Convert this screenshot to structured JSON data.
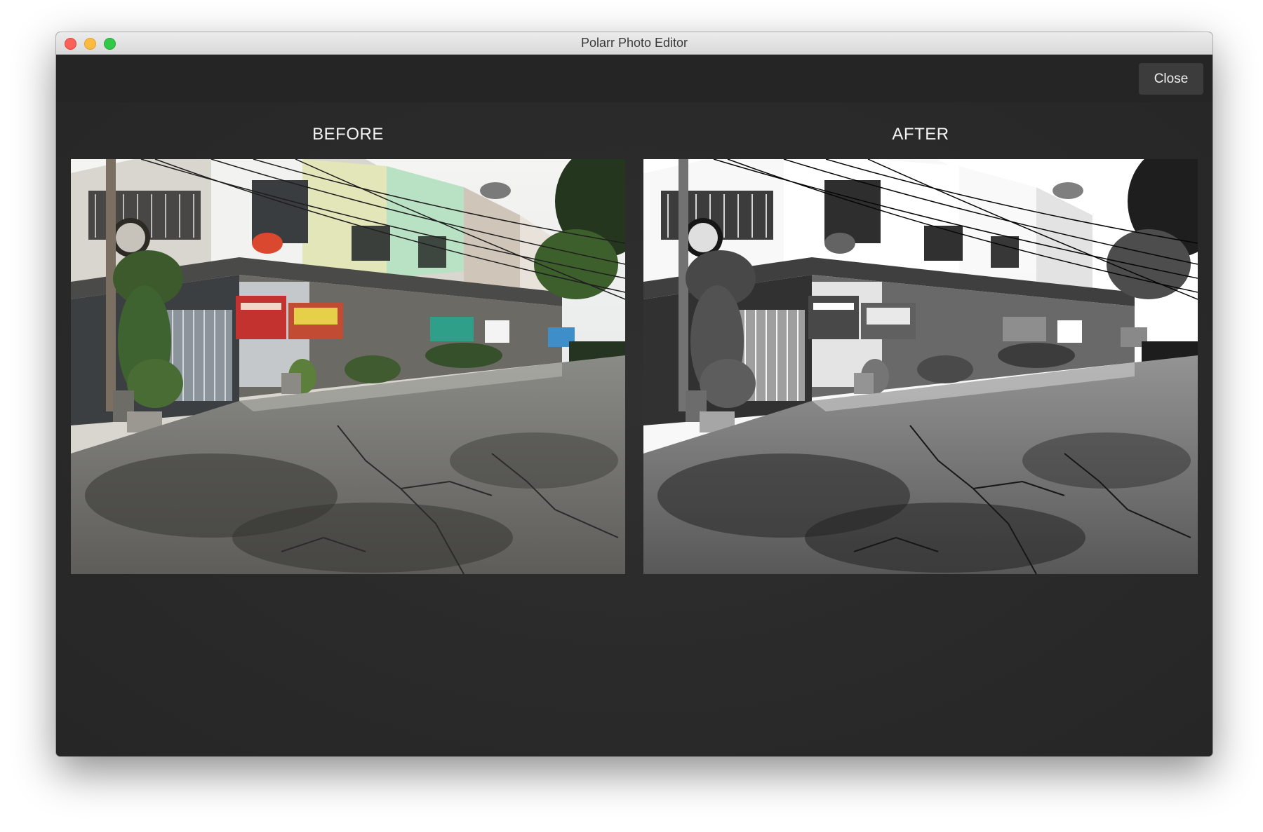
{
  "window": {
    "title": "Polarr Photo Editor",
    "controls": [
      "close",
      "minimize",
      "zoom"
    ]
  },
  "toolbar": {
    "close_label": "Close"
  },
  "comparison": {
    "before_label": "BEFORE",
    "after_label": "AFTER"
  },
  "colors": {
    "toolbar_bg": "#252525",
    "content_bg": "#2b2b2b",
    "button_bg": "#3c3c3c",
    "label_text": "#f2f2f2"
  }
}
